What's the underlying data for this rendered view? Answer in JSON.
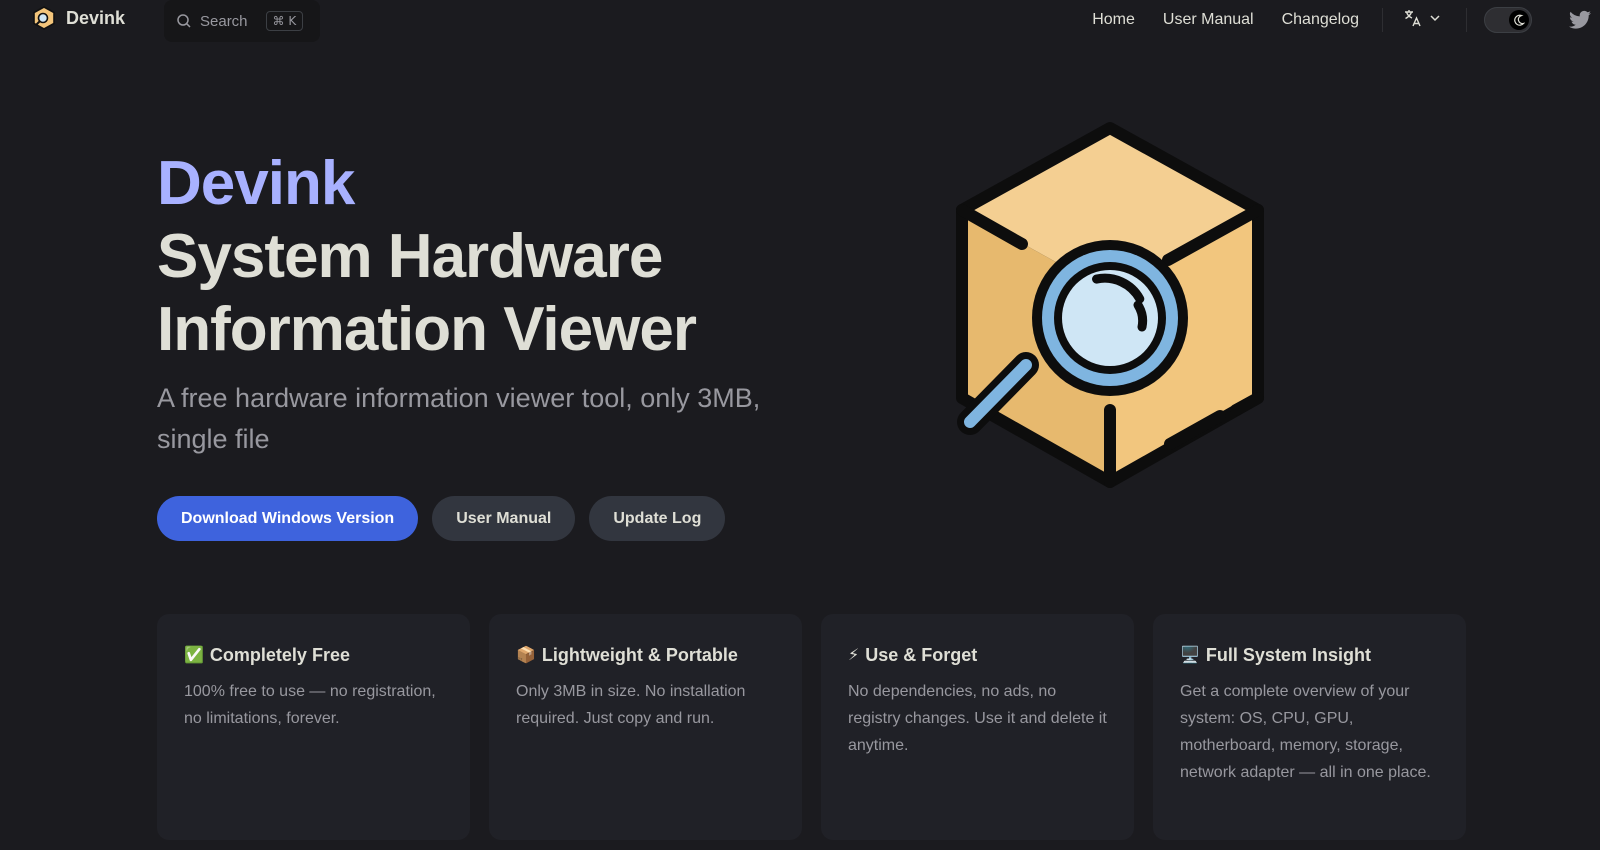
{
  "nav": {
    "brand": "Devink",
    "search_label": "Search",
    "search_kbd": "⌘ K",
    "links": [
      "Home",
      "User Manual",
      "Changelog"
    ]
  },
  "hero": {
    "name": "Devink",
    "title": "System Hardware Information Viewer",
    "tagline": "A free hardware information viewer tool, only 3MB, single file",
    "actions": [
      "Download Windows Version",
      "User Manual",
      "Update Log"
    ]
  },
  "features": [
    {
      "emoji": "✅",
      "title": "Completely Free",
      "desc": "100% free to use — no registration, no limitations, forever."
    },
    {
      "emoji": "📦",
      "title": "Lightweight & Portable",
      "desc": "Only 3MB in size. No installation required. Just copy and run."
    },
    {
      "emoji": "⚡",
      "title": "Use & Forget",
      "desc": "No dependencies, no ads, no registry changes. Use it and delete it anytime."
    },
    {
      "emoji": "🖥️",
      "title": "Full System Insight",
      "desc": "Get a complete overview of your system: OS, CPU, GPU, motherboard, memory, storage, network adapter — all in one place."
    }
  ],
  "colors": {
    "background": "#1b1b1f",
    "brand": "#a8b1ff",
    "button_brand": "#3e63dd",
    "card": "#202127"
  },
  "icons": [
    "logo-icon",
    "search-icon",
    "translate-icon",
    "chevron-down-icon",
    "moon-icon",
    "twitter-icon",
    "box-magnifier-icon"
  ]
}
